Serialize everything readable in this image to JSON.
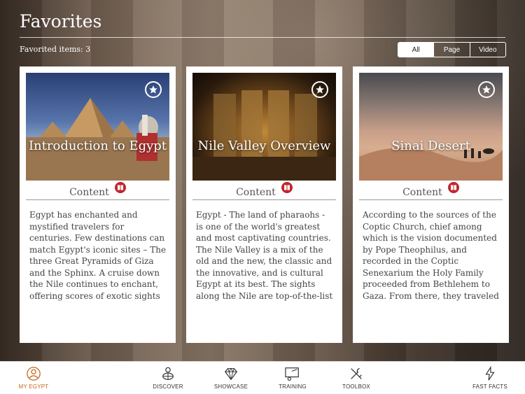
{
  "header": {
    "title": "Favorites",
    "count_text": "Favorited items: 3"
  },
  "filter": {
    "options": [
      "All",
      "Page",
      "Video"
    ],
    "selected": "All"
  },
  "cards": [
    {
      "title": "Introduction to Egypt",
      "type_label": "Content",
      "body": "Egypt has enchanted and mystified travelers for centuries. Few destinations can match Egypt's iconic sites – The three Great Pyramids of Giza and the Sphinx. A cruise down the Nile continues to enchant, offering scores of exotic sights and"
    },
    {
      "title": "Nile Valley Overview",
      "type_label": "Content",
      "body": "Egypt - The land of pharaohs - is one of the world's greatest and most captivating countries. The Nile Valley is a mix of the old and the new, the classic and the innovative, and is cultural Egypt at its best. The sights along the Nile are top-of-the-list for most"
    },
    {
      "title": "Sinai Desert",
      "type_label": "Content",
      "body": "According to the sources of the Coptic Church, chief among which is the vision documented by Pope Theophilus, and recorded in the Coptic Senexarium the Holy Family proceeded from Bethlehem to Gaza. From there, they traveled"
    }
  ],
  "nav": {
    "items": [
      {
        "label": "MY EGYPT",
        "icon": "person-circle-icon",
        "active": true
      },
      {
        "label": "DISCOVER",
        "icon": "person-globe-icon"
      },
      {
        "label": "SHOWCASE",
        "icon": "diamond-icon"
      },
      {
        "label": "TRAINING",
        "icon": "training-icon"
      },
      {
        "label": "TOOLBOX",
        "icon": "tools-icon"
      },
      {
        "label": "FAST FACTS",
        "icon": "lightning-icon"
      }
    ]
  },
  "colors": {
    "accent": "#c8651f",
    "badge": "#c0272d"
  }
}
